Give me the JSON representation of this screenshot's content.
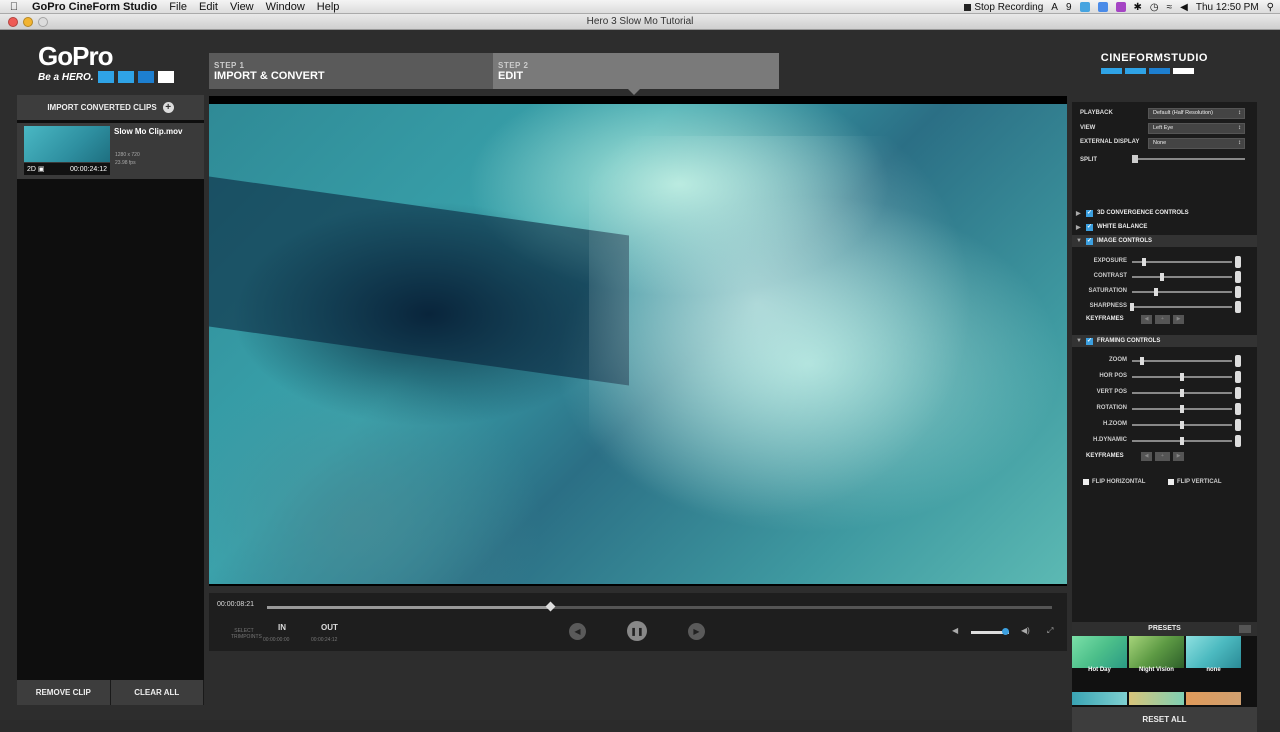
{
  "menubar": {
    "app_name": "GoPro CineForm Studio",
    "menus": [
      "File",
      "Edit",
      "View",
      "Window",
      "Help"
    ],
    "stop_recording": "Stop Recording",
    "ai_count": "9",
    "clock": "Thu 12:50 PM"
  },
  "window": {
    "title": "Hero 3 Slow Mo Tutorial"
  },
  "brand": {
    "logo": "GoPro",
    "tagline": "Be a HERO.",
    "studio": "CINEFORMSTUDIO",
    "accent": "#2fa3e6"
  },
  "steps": [
    {
      "num": "STEP 1",
      "label": "IMPORT & CONVERT"
    },
    {
      "num": "STEP 2",
      "label": "EDIT"
    }
  ],
  "left": {
    "import_label": "IMPORT CONVERTED CLIPS",
    "clip": {
      "name": "Slow Mo Clip.mov",
      "resolution": "1280 x 720",
      "fps": "23.98 fps",
      "mode": "2D",
      "duration": "00:00:24:12"
    },
    "remove_label": "REMOVE CLIP",
    "clear_label": "CLEAR ALL"
  },
  "transport": {
    "timecode": "00:00:08:21",
    "progress": 0.36,
    "select_trim": "SELECT TRIMPOINTS",
    "in_label": "IN",
    "in_value": "00:00:00:00",
    "out_label": "OUT",
    "out_value": "00:00:24:12",
    "volume": 1.0
  },
  "settings": {
    "playback_label": "PLAYBACK",
    "playback_value": "Default (Half Resolution)",
    "view_label": "VIEW",
    "view_value": "Left Eye",
    "external_label": "EXTERNAL DISPLAY",
    "external_value": "None",
    "split_label": "SPLIT"
  },
  "sections": {
    "convergence": "3D CONVERGENCE CONTROLS",
    "white_balance": "WHITE BALANCE",
    "image_controls": "IMAGE CONTROLS",
    "framing_controls": "FRAMING CONTROLS"
  },
  "image_sliders": [
    {
      "label": "EXPOSURE",
      "value": 0.12
    },
    {
      "label": "CONTRAST",
      "value": 0.3
    },
    {
      "label": "SATURATION",
      "value": 0.24
    },
    {
      "label": "SHARPNESS",
      "value": 0.0
    }
  ],
  "framing_sliders": [
    {
      "label": "ZOOM",
      "value": 0.1
    },
    {
      "label": "HOR POS",
      "value": 0.5
    },
    {
      "label": "VERT POS",
      "value": 0.5
    },
    {
      "label": "ROTATION",
      "value": 0.5
    },
    {
      "label": "H.ZOOM",
      "value": 0.5
    },
    {
      "label": "H.DYNAMIC",
      "value": 0.5
    }
  ],
  "keyframes_label": "KEYFRAMES",
  "flip_horizontal": "FLIP HORIZONTAL",
  "flip_vertical": "FLIP VERTICAL",
  "presets": {
    "header": "PRESETS",
    "items": [
      "Hot Day",
      "Night Vision",
      "none"
    ],
    "reset_label": "RESET ALL"
  }
}
